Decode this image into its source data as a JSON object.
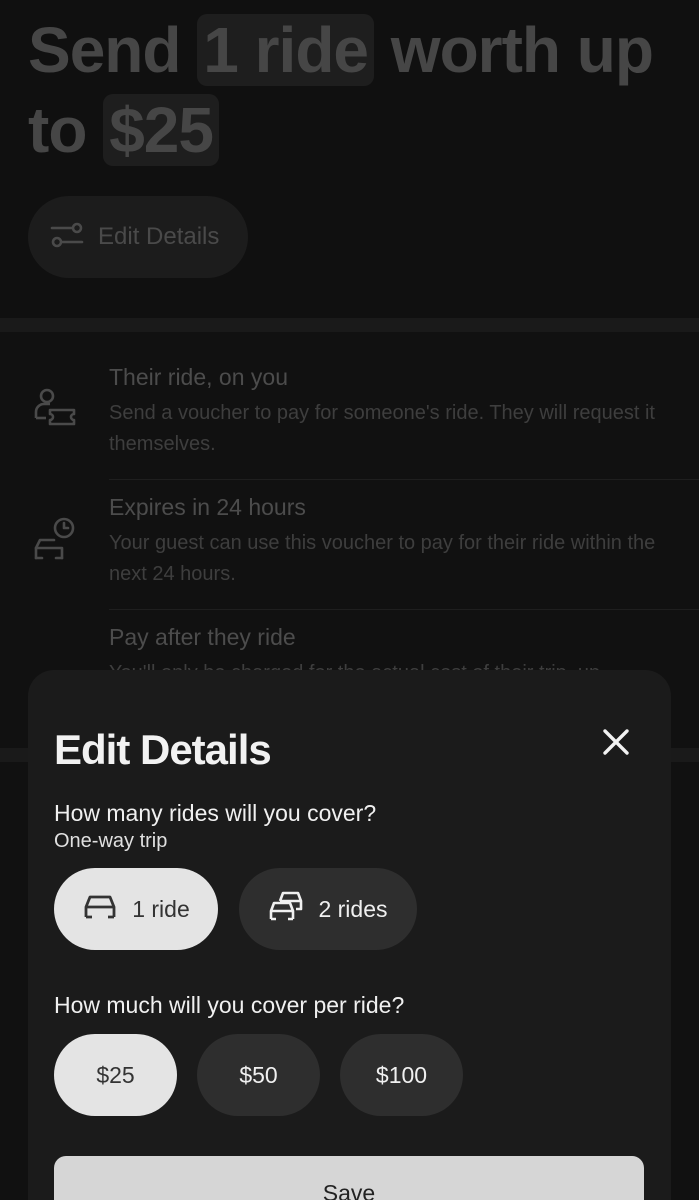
{
  "headline": {
    "part1": "Send ",
    "rides_chip": "1 ride",
    "part2": " worth up to ",
    "amount_chip": "$25"
  },
  "edit_pill": {
    "label": "Edit Details",
    "icon": "sliders-icon"
  },
  "info_items": [
    {
      "icon": "person-voucher-icon",
      "title": "Their ride, on you",
      "description": "Send a voucher to pay for someone's ride. They will request it themselves."
    },
    {
      "icon": "car-clock-icon",
      "title": "Expires in 24 hours",
      "description": "Your guest can use this voucher to pay for their ride within the next 24 hours."
    },
    {
      "icon": "lock-icon",
      "title": "Pay after they ride",
      "description": "You'll only be charged for the actual cost of their trip, up"
    }
  ],
  "sheet": {
    "title": "Edit Details",
    "close_icon": "close-icon",
    "rides_question": "How many rides will you cover?",
    "rides_subtitle": "One-way trip",
    "ride_options": [
      {
        "label": "1 ride",
        "icon": "car-icon",
        "selected": true
      },
      {
        "label": "2 rides",
        "icon": "two-cars-icon",
        "selected": false
      }
    ],
    "amount_question": "How much will you cover per ride?",
    "amount_options": [
      {
        "label": "$25",
        "selected": true
      },
      {
        "label": "$50",
        "selected": false
      },
      {
        "label": "$100",
        "selected": false
      }
    ],
    "save_label": "Save"
  },
  "colors": {
    "sheet_background": "#1b1b1b",
    "selected_pill": "#e4e4e4",
    "unselected_pill": "#2e2e2e",
    "save_button": "#d6d6d6"
  }
}
